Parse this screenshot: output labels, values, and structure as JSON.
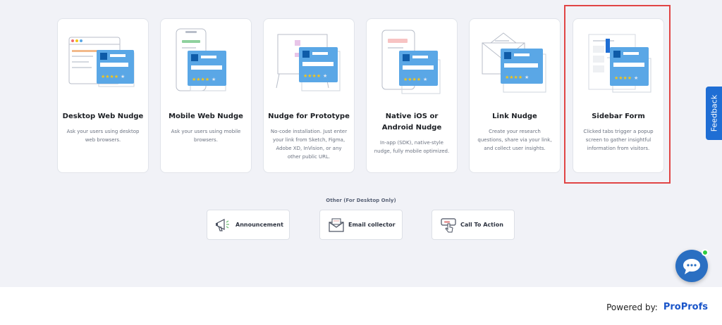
{
  "cards": [
    {
      "title": "Desktop Web Nudge",
      "desc": "Ask your users using desktop web browsers."
    },
    {
      "title": "Mobile Web Nudge",
      "desc": "Ask your users using mobile browsers."
    },
    {
      "title": "Nudge for Prototype",
      "desc": "No-code installation. Just enter your link from Sketch, Figma, Adobe XD, InVision, or any other public URL."
    },
    {
      "title": "Native iOS or Android Nudge",
      "desc": "In-app (SDK), native-style nudge, fully mobile optimized."
    },
    {
      "title": "Link Nudge",
      "desc": "Create your research questions, share via your link, and collect user insights."
    },
    {
      "title": "Sidebar Form",
      "desc": "Clicked tabs trigger a popup screen to gather insightful information from visitors."
    }
  ],
  "other": {
    "title": "Other (For Desktop Only)",
    "buttons": [
      {
        "label": "Announcement",
        "icon": "megaphone-icon"
      },
      {
        "label": "Email collector",
        "icon": "envelope-icon"
      },
      {
        "label": "Call To Action",
        "icon": "hand-pointer-icon"
      }
    ]
  },
  "feedback": {
    "label": "Feedback"
  },
  "chat": {
    "icon": "chat-bubble-icon"
  },
  "footer": {
    "powered_by": "Powered by:",
    "logo": "ProProfs"
  },
  "colors": {
    "accent": "#1f6ed4",
    "card_blue": "#5aa7e6",
    "star": "#f5c518",
    "highlight": "#e14545"
  }
}
